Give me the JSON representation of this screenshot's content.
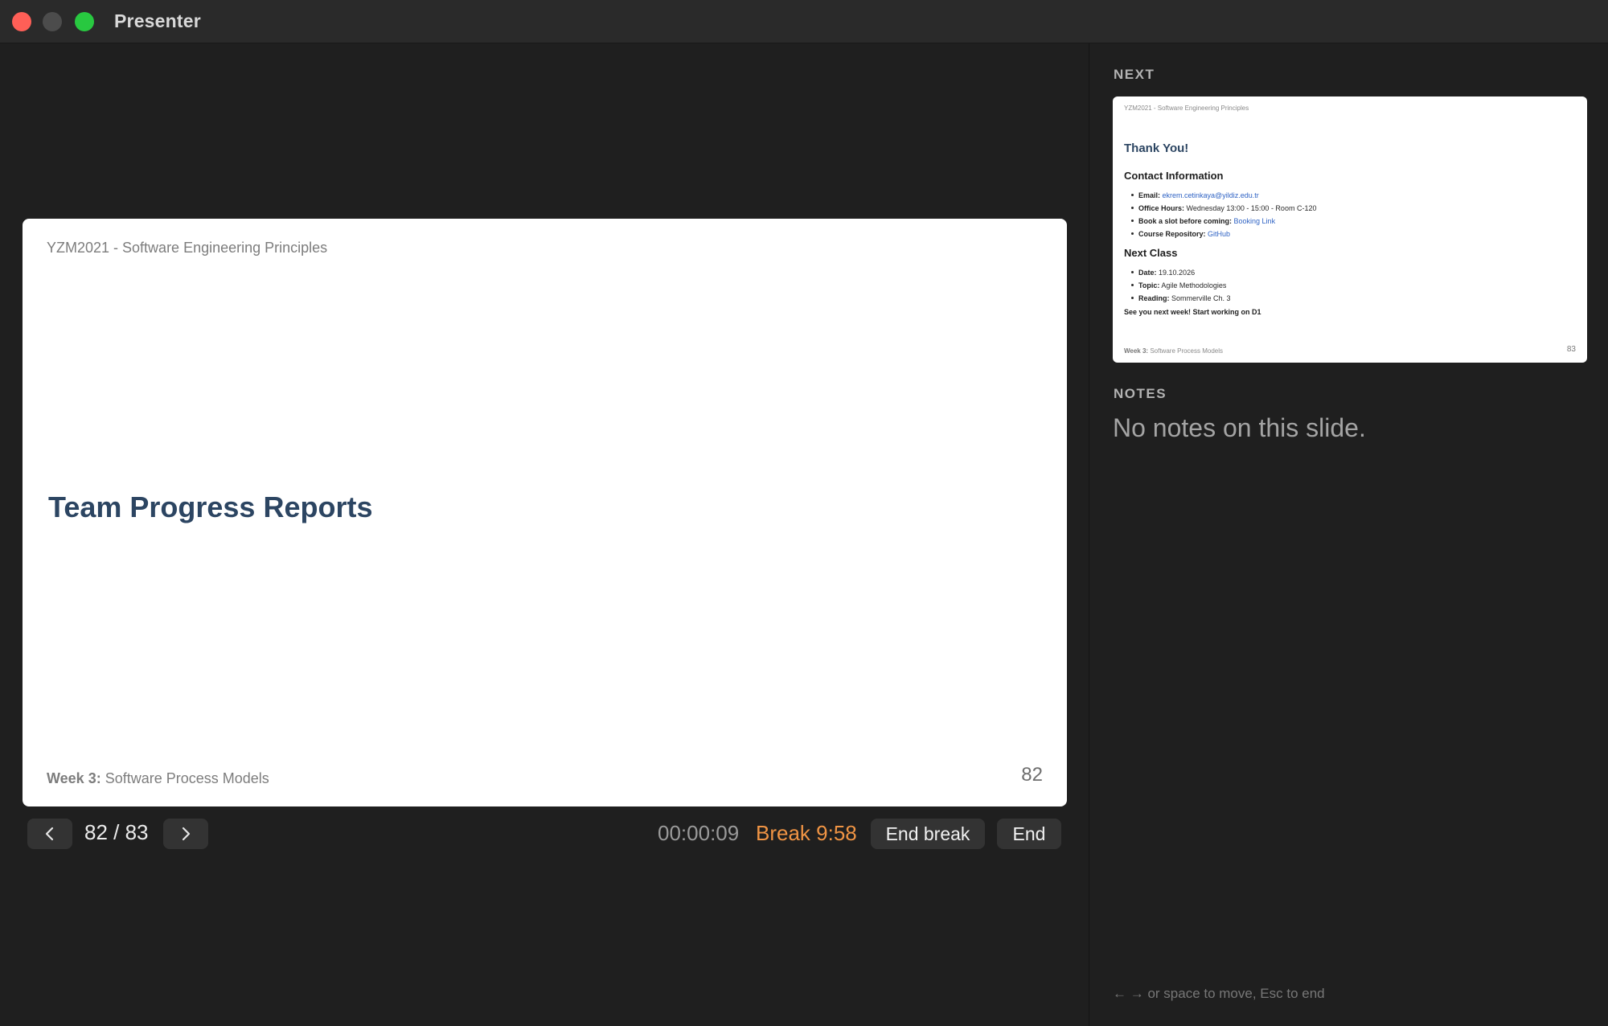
{
  "window": {
    "title": "Presenter"
  },
  "current_slide": {
    "header": "YZM2021 - Software Engineering Principles",
    "title": "Team Progress Reports",
    "footer_bold": "Week 3:",
    "footer_text": " Software Process Models",
    "number": "82"
  },
  "controls": {
    "page_indicator": "82 / 83",
    "elapsed": "00:00:09",
    "break_label": "Break 9:58",
    "end_break_label": "End break",
    "end_label": "End",
    "prev_icon": "chevron-left-icon",
    "next_icon": "chevron-right-icon"
  },
  "sidebar": {
    "next_label": "NEXT",
    "notes_label": "NOTES",
    "notes_text": "No notes on this slide.",
    "hint": "← → or space to move, Esc to end"
  },
  "next_slide": {
    "header": "YZM2021 - Software Engineering Principles",
    "title": "Thank You!",
    "contact_heading": "Contact Information",
    "contact_items": [
      {
        "label": "Email:",
        "value": "ekrem.cetinkaya@yildiz.edu.tr"
      },
      {
        "label": "Office Hours:",
        "value": "Wednesday 13:00 - 15:00 - Room C-120"
      },
      {
        "label": "Book a slot before coming:",
        "value": "Booking Link"
      },
      {
        "label": "Course Repository:",
        "value": "GitHub"
      }
    ],
    "nextclass_heading": "Next Class",
    "nextclass_items": [
      {
        "label": "Date:",
        "value": "19.10.2026"
      },
      {
        "label": "Topic:",
        "value": "Agile Methodologies"
      },
      {
        "label": "Reading:",
        "value": "Sommerville Ch. 3"
      }
    ],
    "closing": "See you next week! Start working on D1",
    "footer_bold": "Week 3:",
    "footer_text": " Software Process Models",
    "number": "83"
  },
  "colors": {
    "accent_break": "#f09444",
    "slide_title": "#2c4562",
    "link": "#2f63c4",
    "close": "#fe5f57",
    "maximize": "#28c840"
  }
}
